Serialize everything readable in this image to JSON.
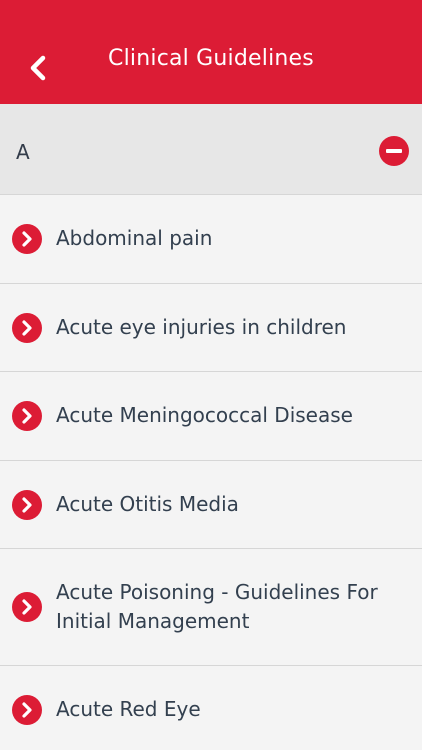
{
  "header": {
    "title": "Clinical Guidelines",
    "back_icon": "chevron-left-icon",
    "background": "#dc1c35"
  },
  "section": {
    "letter": "A",
    "toggle_icon": "minus-circle-icon"
  },
  "items": [
    {
      "label": "Abdominal pain",
      "icon": "chevron-right-circle-icon"
    },
    {
      "label": "Acute eye injuries in children",
      "icon": "chevron-right-circle-icon"
    },
    {
      "label": "Acute Meningococcal Disease",
      "icon": "chevron-right-circle-icon"
    },
    {
      "label": "Acute Otitis Media",
      "icon": "chevron-right-circle-icon"
    },
    {
      "label": "Acute Poisoning - Guidelines For Initial Management",
      "icon": "chevron-right-circle-icon"
    },
    {
      "label": "Acute Red Eye",
      "icon": "chevron-right-circle-icon"
    }
  ],
  "colors": {
    "accent": "#dc1c35",
    "text": "#33404f",
    "row_bg": "#f4f4f4",
    "section_bg": "#e7e7e7"
  }
}
